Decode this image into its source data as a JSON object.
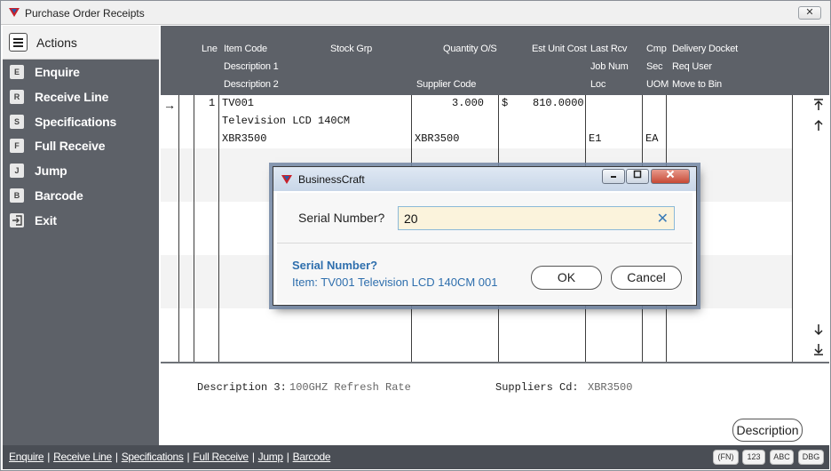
{
  "window": {
    "title": "Purchase Order Receipts",
    "close_label": "✕"
  },
  "colors": {
    "sidebar": "#5d6168",
    "accent_blue": "#2f6fad",
    "input_bg": "#fbf3dc"
  },
  "sidebar": {
    "header": "Actions",
    "items": [
      {
        "key": "E",
        "label": "Enquire"
      },
      {
        "key": "R",
        "label": "Receive Line"
      },
      {
        "key": "S",
        "label": "Specifications"
      },
      {
        "key": "F",
        "label": "Full Receive"
      },
      {
        "key": "J",
        "label": "Jump"
      },
      {
        "key": "B",
        "label": "Barcode"
      },
      {
        "key": "",
        "label": "Exit",
        "icon": "exit-icon"
      }
    ]
  },
  "grid": {
    "headers": {
      "lne": "Lne",
      "item_code": "Item Code",
      "stock_grp": "Stock Grp",
      "qty_os": "Quantity O/S",
      "est_unit_cost": "Est Unit Cost",
      "last_rcv": "Last Rcv",
      "cmp": "Cmp",
      "delivery_docket": "Delivery Docket",
      "description1": "Description 1",
      "job_num": "Job Num",
      "sec": "Sec",
      "req_user": "Req User",
      "description2": "Description 2",
      "supplier_code": "Supplier Code",
      "loc": "Loc",
      "uom": "UOM",
      "move_to_bin": "Move to Bin"
    },
    "rows": [
      {
        "lne": "1",
        "item_code": "TV001",
        "quantity": "3.000",
        "currency": "$",
        "est_unit_cost": "810.0000",
        "description1": "Television LCD 140CM",
        "description2": "XBR3500",
        "supplier_code": "XBR3500",
        "loc": "E1",
        "uom": "EA"
      }
    ]
  },
  "detail": {
    "description3_label": "Description 3:",
    "description3_value": "100GHZ Refresh Rate",
    "suppliers_cd_label": "Suppliers Cd:",
    "suppliers_cd_value": "XBR3500",
    "description_button": "Description"
  },
  "footer": {
    "links": [
      "Enquire",
      "Receive Line",
      "Specifications",
      "Full Receive",
      "Jump",
      "Barcode"
    ],
    "separator": "|",
    "keys": [
      "(FN)",
      "123",
      "ABC",
      "DBG"
    ]
  },
  "dialog": {
    "title": "BusinessCraft",
    "prompt": "Serial Number?",
    "input_value": "20",
    "info_title": "Serial Number?",
    "info_item": "Item: TV001 Television LCD 140CM 001",
    "ok_label": "OK",
    "cancel_label": "Cancel"
  }
}
